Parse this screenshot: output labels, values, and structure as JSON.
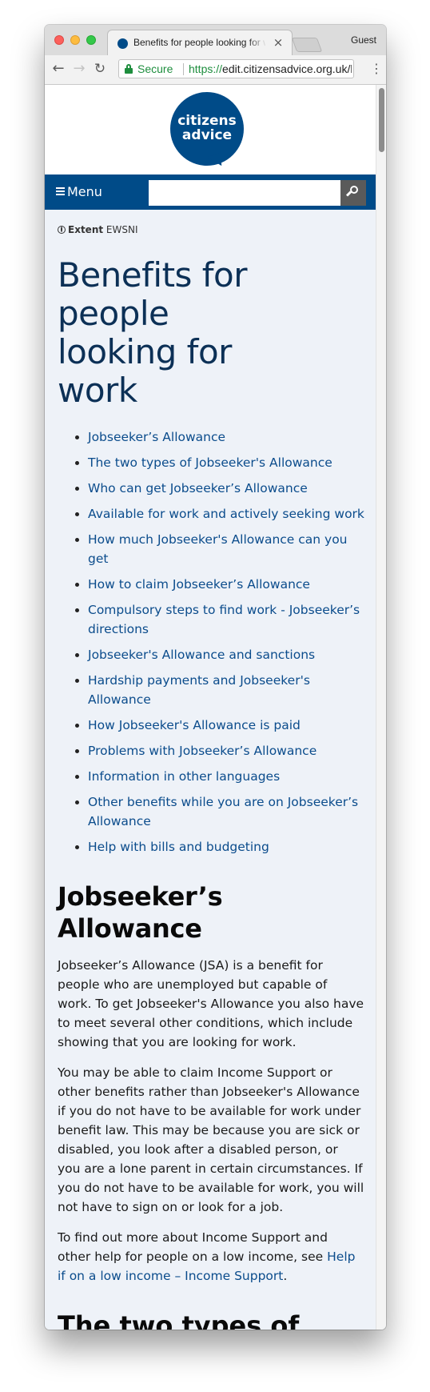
{
  "browser": {
    "tab_title": "Benefits for people looking for work",
    "tab_close": "×",
    "profile": "Guest",
    "secure_label": "Secure",
    "url_scheme": "https://",
    "url_rest": "edit.citizensadvice.org.uk/benefits/..."
  },
  "site": {
    "logo_line1": "citizens",
    "logo_line2": "advice",
    "menu_label": "Menu",
    "search_placeholder": "",
    "extent_label": "Extent",
    "extent_value": "EWSNI"
  },
  "page": {
    "title": "Benefits for people looking for work",
    "toc": [
      "Jobseeker’s Allowance",
      "The two types of Jobseeker's Allowance",
      "Who can get Jobseeker’s Allowance",
      "Available for work and actively seeking work",
      "How much Jobseeker's Allowance can you get",
      "How to claim Jobseeker’s Allowance",
      "Compulsory steps to find work - Jobseeker’s directions",
      "Jobseeker's Allowance and sanctions",
      "Hardship payments and Jobseeker's Allowance",
      "How Jobseeker's Allowance is paid",
      "Problems with Jobseeker’s Allowance",
      "Information in other languages",
      "Other benefits while you are on Jobseeker’s Allowance",
      "Help with bills and budgeting"
    ],
    "section_title": "Jobseeker’s Allowance",
    "para1": "Jobseeker’s Allowance (JSA) is a benefit for people who are unemployed but capable of work. To get Jobseeker's Allowance you also have to meet several other conditions, which include showing that you are looking for work.",
    "para2": "You may be able to claim Income Support or other benefits rather than Jobseeker's Allowance if you do not have to be available for work under benefit law. This may be because you are sick or disabled, you look after a disabled person, or you are a lone parent in certain circumstances. If you do not have to be available for work, you will not have to sign on or look for a job.",
    "para3_prefix": "To find out more about Income Support and other help for people on a low income, see ",
    "para3_link": "Help if on a low income – Income Support",
    "para3_suffix": ".",
    "next_title": "The two types of"
  }
}
